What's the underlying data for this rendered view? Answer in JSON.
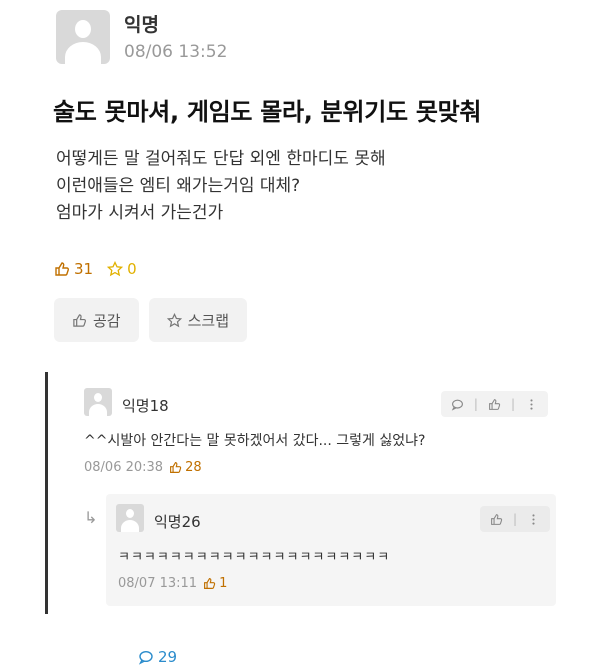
{
  "post": {
    "author": "익명",
    "date": "08/06 13:52",
    "title": "술도 못마셔, 게임도 몰라, 분위기도 못맞춰",
    "content": [
      "어떻게든 말 걸어줘도 단답 외엔 한마디도 못해",
      "이런애들은 엠티 왜가는거임 대체?",
      "엄마가 시켜서 가는건가"
    ],
    "likes": "31",
    "comments": "29",
    "scraps": "0",
    "like_button": "공감",
    "scrap_button": "스크랩"
  },
  "comment": {
    "author": "익명18",
    "text": "^^시발아 안간다는 말 못하겠어서 갔다... 그렇게 싫었냐?",
    "date": "08/06 20:38",
    "likes": "28"
  },
  "reply": {
    "author": "익명26",
    "text": "ㅋㅋㅋㅋㅋㅋㅋㅋㅋㅋㅋㅋㅋㅋㅋㅋㅋㅋㅋㅋㅋ",
    "date": "08/07 13:11",
    "likes": "1"
  },
  "icons": {
    "reply_arrow": "↳"
  },
  "colors": {
    "like": "#c07000",
    "comment": "#2b8ccc",
    "scrap": "#e1b100"
  }
}
